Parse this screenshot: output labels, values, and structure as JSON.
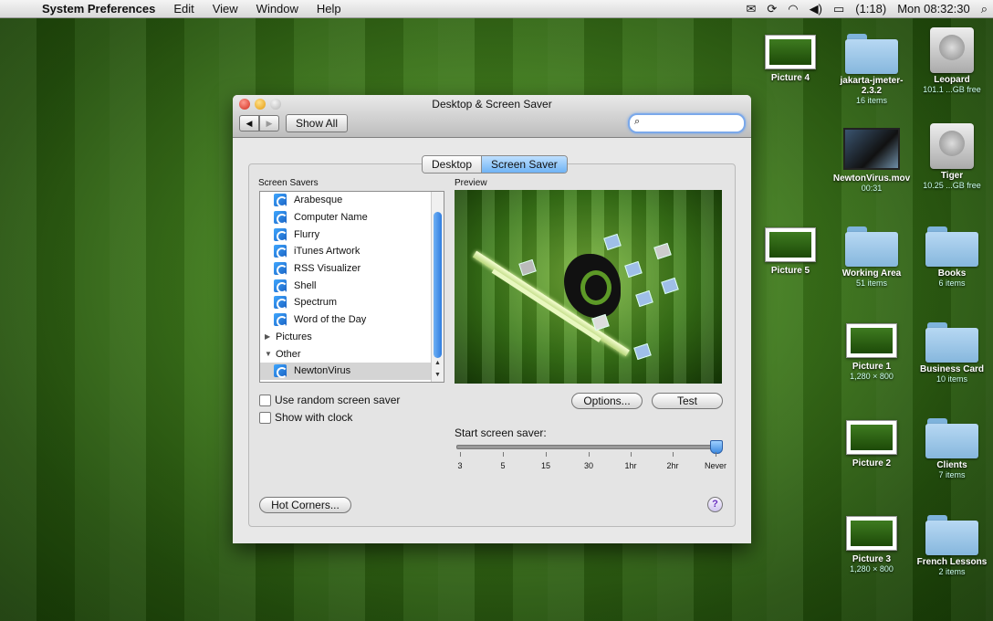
{
  "menubar": {
    "app": "System Preferences",
    "menus": [
      "Edit",
      "View",
      "Window",
      "Help"
    ],
    "battery": "(1:18)",
    "clock": "Mon 08:32:30"
  },
  "window": {
    "title": "Desktop & Screen Saver",
    "show_all": "Show All",
    "search_placeholder": ""
  },
  "tabs": [
    "Desktop",
    "Screen Saver"
  ],
  "screen_savers": {
    "label": "Screen Savers",
    "items": [
      "Arabesque",
      "Computer Name",
      "Flurry",
      "iTunes Artwork",
      "RSS Visualizer",
      "Shell",
      "Spectrum",
      "Word of the Day"
    ],
    "group_pictures": "Pictures",
    "group_other": "Other",
    "selected": "NewtonVirus"
  },
  "options": {
    "random": "Use random screen saver",
    "clock": "Show with clock"
  },
  "preview": {
    "label": "Preview",
    "options_button": "Options...",
    "test_button": "Test"
  },
  "start": {
    "label": "Start screen saver:",
    "ticks": [
      "3",
      "5",
      "15",
      "30",
      "1hr",
      "2hr",
      "Never"
    ],
    "selected": "Never"
  },
  "hot_corners": "Hot Corners...",
  "help": "?",
  "desktop_icons": [
    {
      "label": "Picture 4",
      "sub": ""
    },
    {
      "label": "jakarta-jmeter-2.3.2",
      "sub": "16 items"
    },
    {
      "label": "Leopard",
      "sub": "101.1 ...GB free"
    },
    {
      "label": "NewtonVirus.mov",
      "sub": "00:31"
    },
    {
      "label": "Tiger",
      "sub": "10.25 ...GB free"
    },
    {
      "label": "Picture 5",
      "sub": ""
    },
    {
      "label": "Working Area",
      "sub": "51 items"
    },
    {
      "label": "Books",
      "sub": "6 items"
    },
    {
      "label": "Picture 1",
      "sub": "1,280 × 800"
    },
    {
      "label": "Business Card",
      "sub": "10 items"
    },
    {
      "label": "Picture 2",
      "sub": ""
    },
    {
      "label": "Clients",
      "sub": "7 items"
    },
    {
      "label": "Picture 3",
      "sub": "1,280 × 800"
    },
    {
      "label": "French Lessons",
      "sub": "2 items"
    }
  ]
}
